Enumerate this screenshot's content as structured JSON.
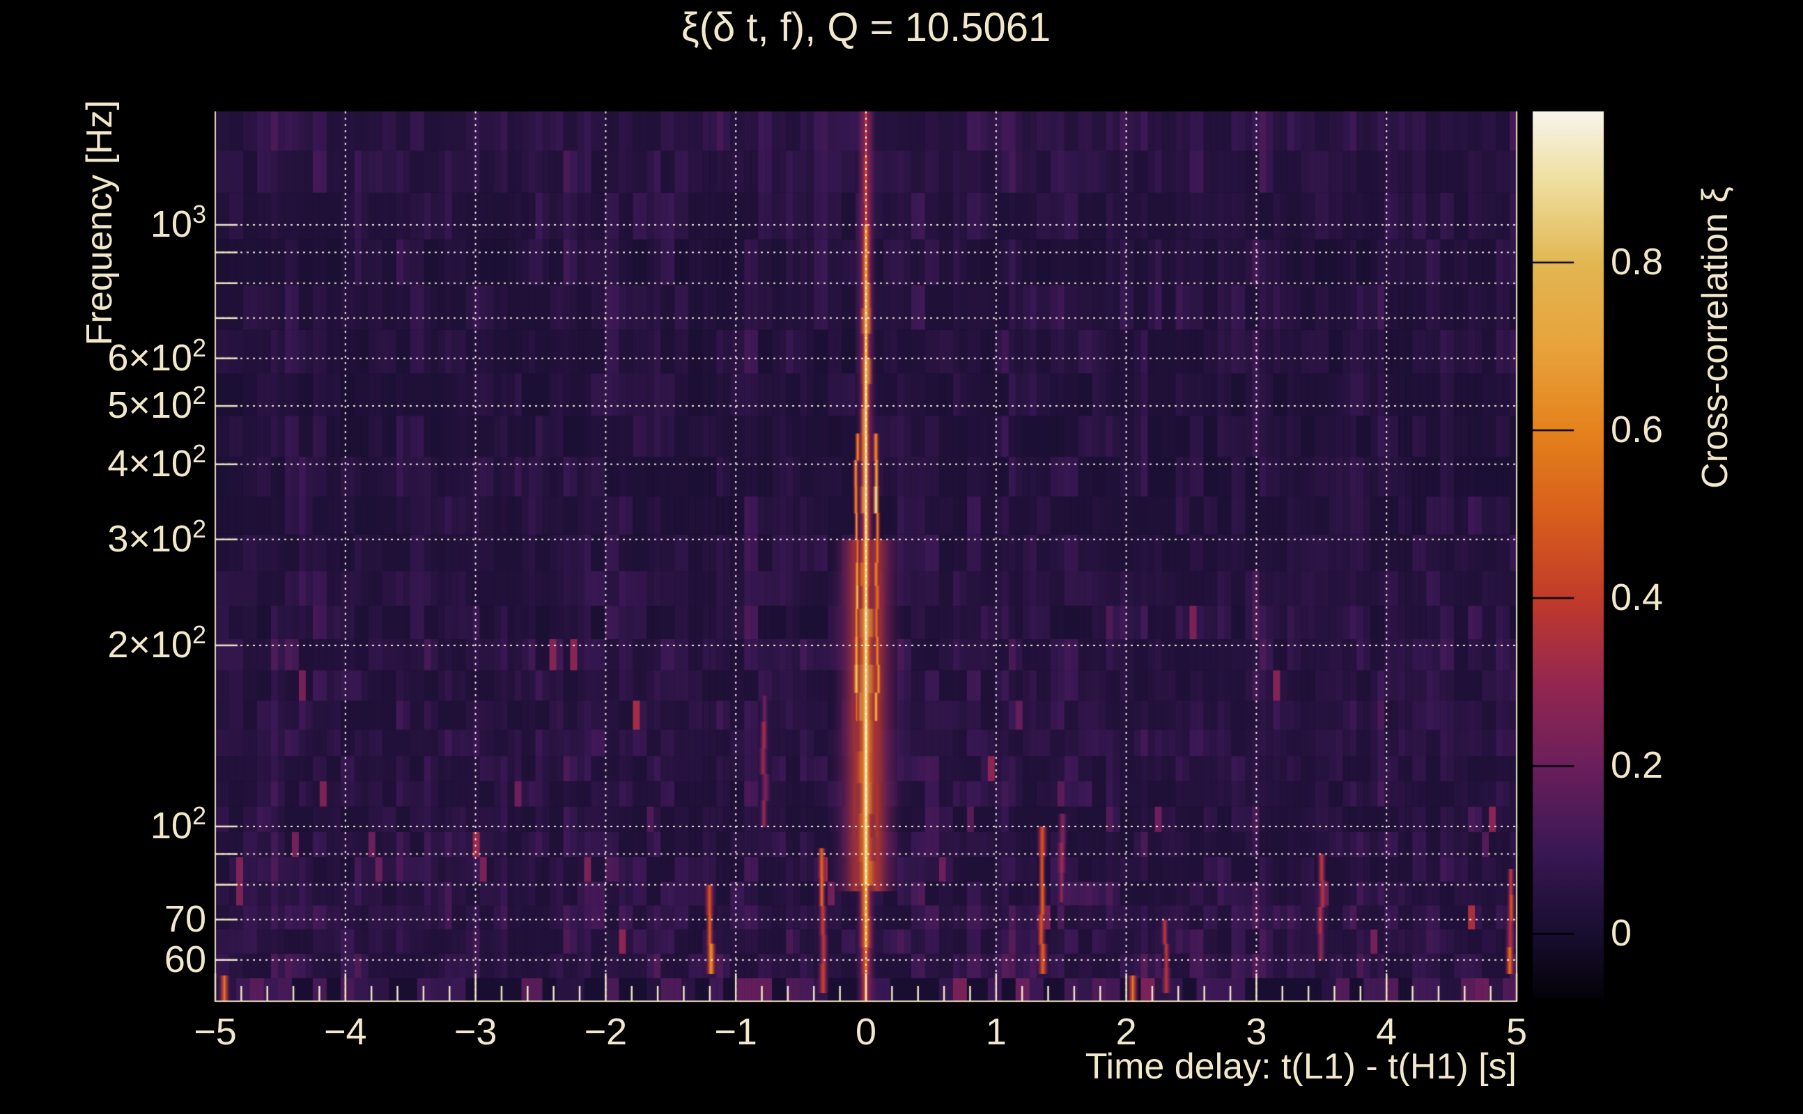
{
  "title": "ξ(δ t, f), Q = 10.5061",
  "x_axis": {
    "label": "Time delay: t(L1) - t(H1) [s]",
    "range": [
      -5,
      5
    ],
    "minor_tick_step": 0.2,
    "ticks": [
      {
        "value": -5,
        "label": "−5"
      },
      {
        "value": -4,
        "label": "−4"
      },
      {
        "value": -3,
        "label": "−3"
      },
      {
        "value": -2,
        "label": "−2"
      },
      {
        "value": -1,
        "label": "−1"
      },
      {
        "value": 0,
        "label": "0"
      },
      {
        "value": 1,
        "label": "1"
      },
      {
        "value": 2,
        "label": "2"
      },
      {
        "value": 3,
        "label": "3"
      },
      {
        "value": 4,
        "label": "4"
      },
      {
        "value": 5,
        "label": "5"
      }
    ]
  },
  "y_axis": {
    "label": "Frequency [Hz]",
    "scale": "log",
    "range_hz": [
      51.2,
      1544
    ],
    "ticks": [
      {
        "value": 1000,
        "base": "10",
        "sup": "3"
      },
      {
        "value": 600,
        "base": "6×10",
        "sup": "2"
      },
      {
        "value": 500,
        "base": "5×10",
        "sup": "2"
      },
      {
        "value": 400,
        "base": "4×10",
        "sup": "2"
      },
      {
        "value": 300,
        "base": "3×10",
        "sup": "2"
      },
      {
        "value": 200,
        "base": "2×10",
        "sup": "2"
      },
      {
        "value": 100,
        "base": "10",
        "sup": "2"
      },
      {
        "value": 70,
        "base": "70",
        "sup": ""
      },
      {
        "value": 60,
        "base": "60",
        "sup": ""
      }
    ],
    "gridlines_hz": [
      60,
      70,
      80,
      90,
      100,
      200,
      300,
      400,
      500,
      600,
      700,
      800,
      900,
      1000
    ]
  },
  "colorbar": {
    "label": "Cross-correlation ξ",
    "range": [
      -0.077,
      0.98
    ],
    "ticks": [
      {
        "value": 0,
        "label": "0"
      },
      {
        "value": 0.2,
        "label": "0.2"
      },
      {
        "value": 0.4,
        "label": "0.4"
      },
      {
        "value": 0.6,
        "label": "0.6"
      },
      {
        "value": 0.8,
        "label": "0.8"
      }
    ],
    "gradient_stops": [
      {
        "p": 0.0,
        "color": [
          4,
          2,
          8
        ]
      },
      {
        "p": 0.073,
        "color": [
          24,
          14,
          48
        ]
      },
      {
        "p": 0.167,
        "color": [
          58,
          24,
          84
        ]
      },
      {
        "p": 0.262,
        "color": [
          107,
          31,
          92
        ]
      },
      {
        "p": 0.357,
        "color": [
          149,
          39,
          80
        ]
      },
      {
        "p": 0.451,
        "color": [
          194,
          59,
          42
        ]
      },
      {
        "p": 0.546,
        "color": [
          216,
          95,
          28
        ]
      },
      {
        "p": 0.64,
        "color": [
          229,
          130,
          28
        ]
      },
      {
        "p": 0.735,
        "color": [
          232,
          163,
          60
        ]
      },
      {
        "p": 0.829,
        "color": [
          226,
          183,
          82
        ]
      },
      {
        "p": 0.924,
        "color": [
          239,
          224,
          162
        ]
      },
      {
        "p": 1.0,
        "color": [
          248,
          244,
          236
        ]
      }
    ]
  },
  "chart_data": {
    "type": "heatmap",
    "x": "time_delay_s",
    "y": "frequency_hz",
    "z": "cross_correlation_xi",
    "x_range": [
      -5,
      5
    ],
    "y_range_hz": [
      51.2,
      1544
    ],
    "z_range": [
      -0.077,
      0.98
    ],
    "colormap": "magma",
    "q_value": 10.5061,
    "grid": "dotted-white",
    "background_noise_xi": [
      0,
      0.12
    ],
    "ridge_profile": [
      {
        "f_lo": 1300,
        "f_hi": 1544,
        "xi": 0.45,
        "width_s": 0.05
      },
      {
        "f_lo": 1000,
        "f_hi": 1300,
        "xi": 0.5,
        "width_s": 0.055
      },
      {
        "f_lo": 800,
        "f_hi": 1000,
        "xi": 0.78,
        "width_s": 0.075
      },
      {
        "f_lo": 600,
        "f_hi": 800,
        "xi": 0.86,
        "width_s": 0.085
      },
      {
        "f_lo": 450,
        "f_hi": 600,
        "xi": 0.93,
        "width_s": 0.09
      },
      {
        "f_lo": 300,
        "f_hi": 450,
        "xi": 0.96,
        "width_s": 0.09
      },
      {
        "f_lo": 230,
        "f_hi": 300,
        "xi": 0.9,
        "width_s": 0.12
      },
      {
        "f_lo": 150,
        "f_hi": 230,
        "xi": 0.93,
        "width_s": 0.16
      },
      {
        "f_lo": 105,
        "f_hi": 150,
        "xi": 0.98,
        "width_s": 0.2
      },
      {
        "f_lo": 80,
        "f_hi": 105,
        "xi": 0.94,
        "width_s": 0.17
      },
      {
        "f_lo": 63,
        "f_hi": 80,
        "xi": 0.82,
        "width_s": 0.11
      },
      {
        "f_lo": 51.2,
        "f_hi": 63,
        "xi": 0.62,
        "width_s": 0.08
      }
    ],
    "features": [
      {
        "name": "central-ridge",
        "t": 0.0,
        "f_lo": 51.2,
        "f_hi": 1544,
        "xi": 0.97
      },
      {
        "name": "streak",
        "t": -1.2,
        "f_lo": 57,
        "f_hi": 80,
        "xi": 0.55
      },
      {
        "name": "streak",
        "t": -0.78,
        "f_lo": 100,
        "f_hi": 165,
        "xi": 0.3
      },
      {
        "name": "streak",
        "t": -0.33,
        "f_lo": 53,
        "f_hi": 92,
        "xi": 0.5
      },
      {
        "name": "streak",
        "t": 1.35,
        "f_lo": 57,
        "f_hi": 100,
        "xi": 0.6
      },
      {
        "name": "streak",
        "t": 1.5,
        "f_lo": 75,
        "f_hi": 105,
        "xi": 0.35
      },
      {
        "name": "streak",
        "t": 2.3,
        "f_lo": 53,
        "f_hi": 70,
        "xi": 0.35
      },
      {
        "name": "streak",
        "t": 3.5,
        "f_lo": 60,
        "f_hi": 90,
        "xi": 0.35
      },
      {
        "name": "streak",
        "t": 4.95,
        "f_lo": 57,
        "f_hi": 85,
        "xi": 0.5
      },
      {
        "name": "blob",
        "t": -4.93,
        "f_lo": 51.2,
        "f_hi": 56.5,
        "xi": 0.6
      },
      {
        "name": "blob",
        "t": 2.05,
        "f_lo": 51.2,
        "f_hi": 56.5,
        "xi": 0.6
      }
    ],
    "noise_bands": [
      {
        "f_lo": 51.2,
        "f_hi": 56.5,
        "boost": 0.13,
        "pattern": "blocky"
      },
      {
        "f_lo": 56.5,
        "f_hi": 63,
        "boost": 0.1
      },
      {
        "f_lo": 63,
        "f_hi": 100,
        "boost": 0.085
      },
      {
        "f_lo": 100,
        "f_hi": 112,
        "boost": 0.075
      },
      {
        "f_lo": 112,
        "f_hi": 150,
        "boost": 0.05
      },
      {
        "f_lo": 150,
        "f_hi": 175,
        "boost": 0.055
      },
      {
        "f_lo": 175,
        "f_hi": 230,
        "boost": 0.08
      },
      {
        "f_lo": 230,
        "f_hi": 450,
        "boost": 0.04
      },
      {
        "f_lo": 450,
        "f_hi": 700,
        "boost": 0.045
      },
      {
        "f_lo": 700,
        "f_hi": 1000,
        "boost": 0.05
      },
      {
        "f_lo": 1000,
        "f_hi": 1544,
        "boost": 0.055
      }
    ]
  },
  "colors": {
    "background": "#000000",
    "text": "#f2e8cb",
    "gridline": "#fff8e8",
    "frame": "#e9dfbe",
    "tick": "#f0e6c6",
    "colorbar_tick": "#000000"
  }
}
